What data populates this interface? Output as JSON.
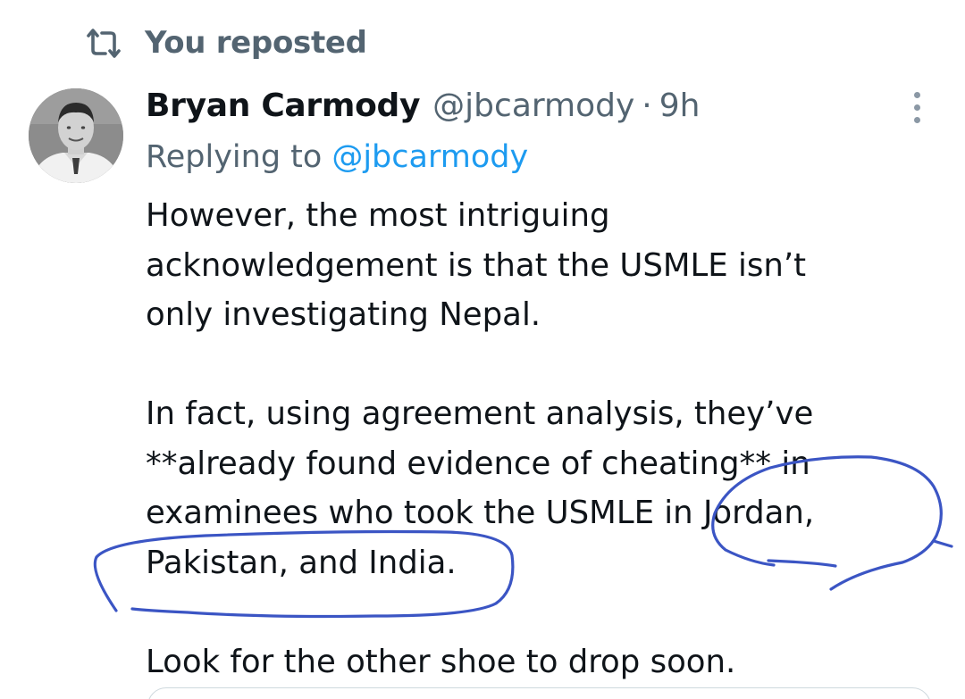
{
  "repost": {
    "icon": "repost-icon",
    "label": "You reposted"
  },
  "tweet": {
    "avatar": "avatar",
    "display_name": "Bryan Carmody",
    "handle": "@jbcarmody",
    "separator": "·",
    "time": "9h",
    "more_icon": "more-options-icon",
    "reply_prefix": "Replying to",
    "reply_handle": "@jbcarmody",
    "lines": [
      "However, the most intriguing",
      "acknowledgement is that the USMLE isn’t",
      "only investigating Nepal.",
      "In fact, using agreement analysis, they’ve",
      "**already found evidence of cheating** in",
      "examinees who took the USMLE in Jordan,",
      "Pakistan, and India.",
      "Look for the other shoe to drop soon."
    ]
  },
  "colors": {
    "text_primary": "#0f1419",
    "text_secondary": "#536471",
    "link": "#1d9bf0",
    "annotation_ink": "#3b55c4"
  }
}
